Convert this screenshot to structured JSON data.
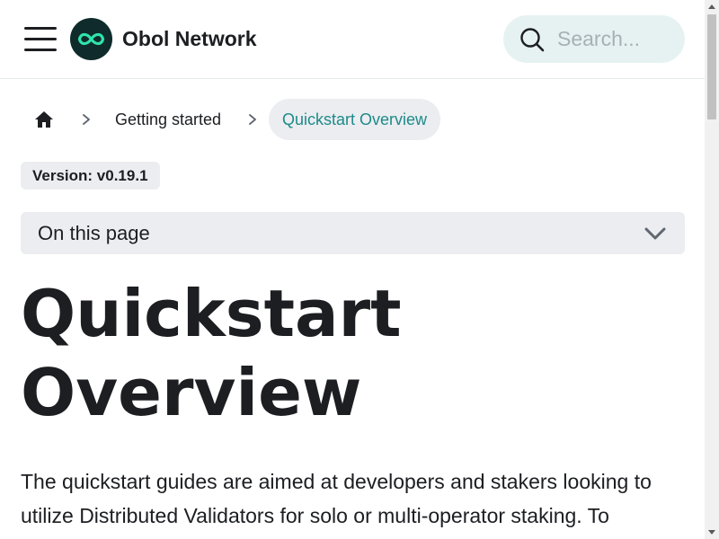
{
  "header": {
    "brand": "Obol Network",
    "search_placeholder": "Search..."
  },
  "icons": {
    "menu": "hamburger-icon",
    "logo": "infinity-logo",
    "search": "search-icon",
    "home": "home-icon",
    "separator": "chevron-right-icon",
    "toc_toggle": "chevron-down-icon"
  },
  "breadcrumbs": {
    "items": [
      "Getting started"
    ],
    "active": "Quickstart Overview"
  },
  "version_badge": "Version: v0.19.1",
  "toc": {
    "label": "On this page"
  },
  "main": {
    "title": "Quickstart Overview",
    "intro": "The quickstart guides are aimed at developers and stakers looking to utilize Distributed Validators for solo or multi-operator staking. To"
  },
  "colors": {
    "accent": "#1e8a8a",
    "logo_bg": "#0f2b2c",
    "logo_mark": "#2fe4ab",
    "search_bg": "#e6f2f2",
    "surface": "#ebedf0",
    "text": "#1c1e21"
  }
}
